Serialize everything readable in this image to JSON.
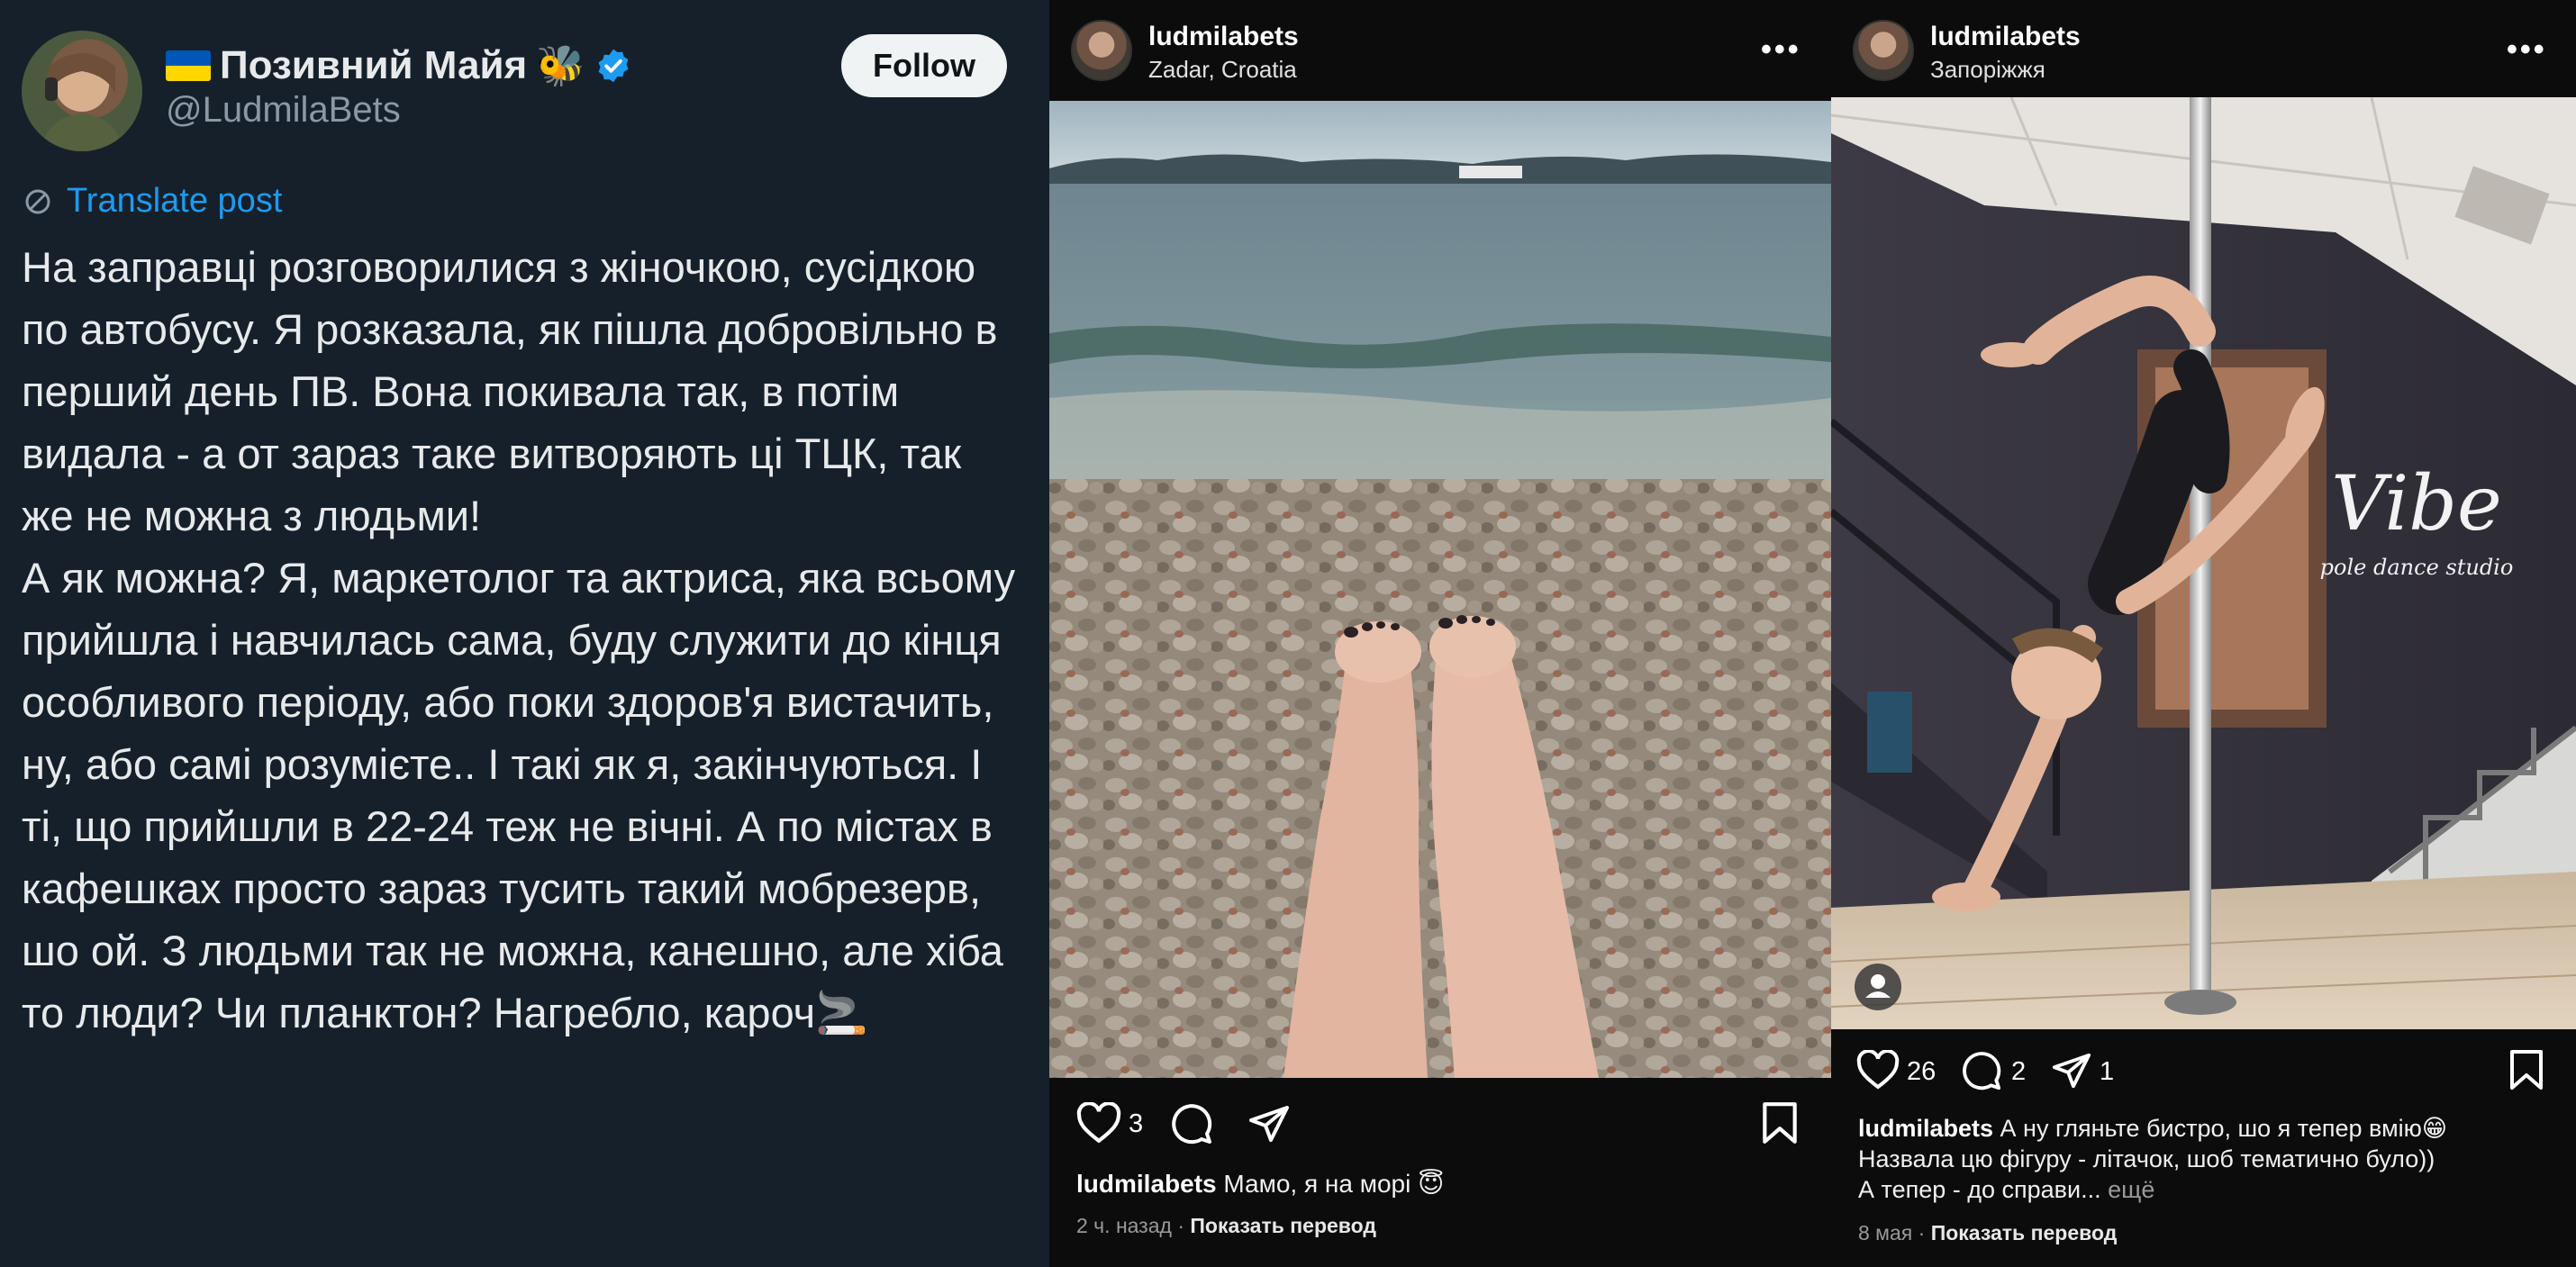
{
  "x_post": {
    "display_name": "Позивний Майя",
    "name_emoji": "🐝",
    "handle": "@LudmilaBets",
    "follow_label": "Follow",
    "translate_label": "Translate post",
    "text": "На заправці розговорилися з жіночкою, сусідкою по автобусу. Я розказала, як пішла добровільно в перший день ПВ. Вона покивала так, в потім видала - а от зараз таке витворяють ці ТЦК, так же не можна з людьми!\nА як можна? Я, маркетолог та актриса, яка всьому прийшла і навчилась сама, буду служити до кінця особливого періоду, або поки здоров'я вистачить, ну, або самі розумієте.. І такі як я, закінчуються. І ті, що прийшли в 22-24 теж не вічні. А по містах в кафешках просто зараз тусить такий мобрезерв, шо ой. З людьми так не можна, канешно, але хіба то люди? Чи планктон? Нагребло, кароч🚬",
    "accent_color": "#1d9bf0"
  },
  "ig_post_1": {
    "username": "ludmilabets",
    "location": "Zadar, Croatia",
    "more_label": "•••",
    "likes": "3",
    "caption_user": "ludmilabets",
    "caption_text": "Мамо, я на морі 😇",
    "time": "2 ч. назад",
    "separator": " · ",
    "translate_label": "Показать перевод"
  },
  "ig_post_2": {
    "username": "ludmilabets",
    "location": "Запоріжжя",
    "more_label": "•••",
    "likes": "26",
    "comments": "2",
    "shares": "1",
    "caption_user": "ludmilabets",
    "caption_line1": "А ну гляньте бистро, шо я тепер вмію😁",
    "caption_line2": "Назвала цю фігуру - літачок, шоб тематично було))",
    "caption_line3": "А тепер - до справи...",
    "more_text": "ещё",
    "studio_logo": "Vibe",
    "studio_sub": "pole dance studio",
    "time": "8 мая",
    "separator": " · ",
    "translate_label": "Показать перевод"
  }
}
